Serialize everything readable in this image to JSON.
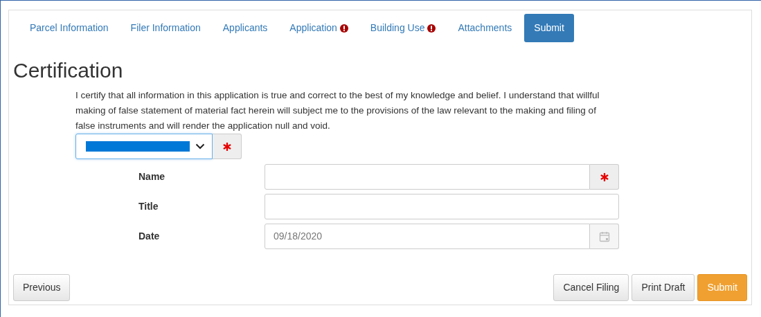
{
  "tabs": [
    {
      "label": "Parcel Information",
      "error": false,
      "selected": false
    },
    {
      "label": "Filer Information",
      "error": false,
      "selected": false
    },
    {
      "label": "Applicants",
      "error": false,
      "selected": false
    },
    {
      "label": "Application",
      "error": true,
      "selected": false
    },
    {
      "label": "Building Use",
      "error": true,
      "selected": false
    },
    {
      "label": "Attachments",
      "error": false,
      "selected": false
    },
    {
      "label": "Submit",
      "error": false,
      "selected": true
    }
  ],
  "heading": "Certification",
  "statement": "I certify that all information in this application is true and correct to the best of my knowledge and belief. I understand that willful making of false statement of material fact herein will subject me to the provisions of the law relevant to the making and filing of false instruments and will render the application null and void.",
  "certify_select": {
    "required": true
  },
  "fields": [
    {
      "label": "Name",
      "kind": "text",
      "required": true
    },
    {
      "label": "Title",
      "kind": "text",
      "required": false
    },
    {
      "label": "Date",
      "kind": "date",
      "required": false,
      "value": "09/18/2020"
    }
  ],
  "left_buttons": [
    {
      "label": "Previous",
      "kind": "default"
    }
  ],
  "right_buttons": [
    {
      "label": "Cancel Filing",
      "kind": "default"
    },
    {
      "label": "Print Draft",
      "kind": "default"
    },
    {
      "label": "Submit",
      "kind": "primary"
    }
  ]
}
